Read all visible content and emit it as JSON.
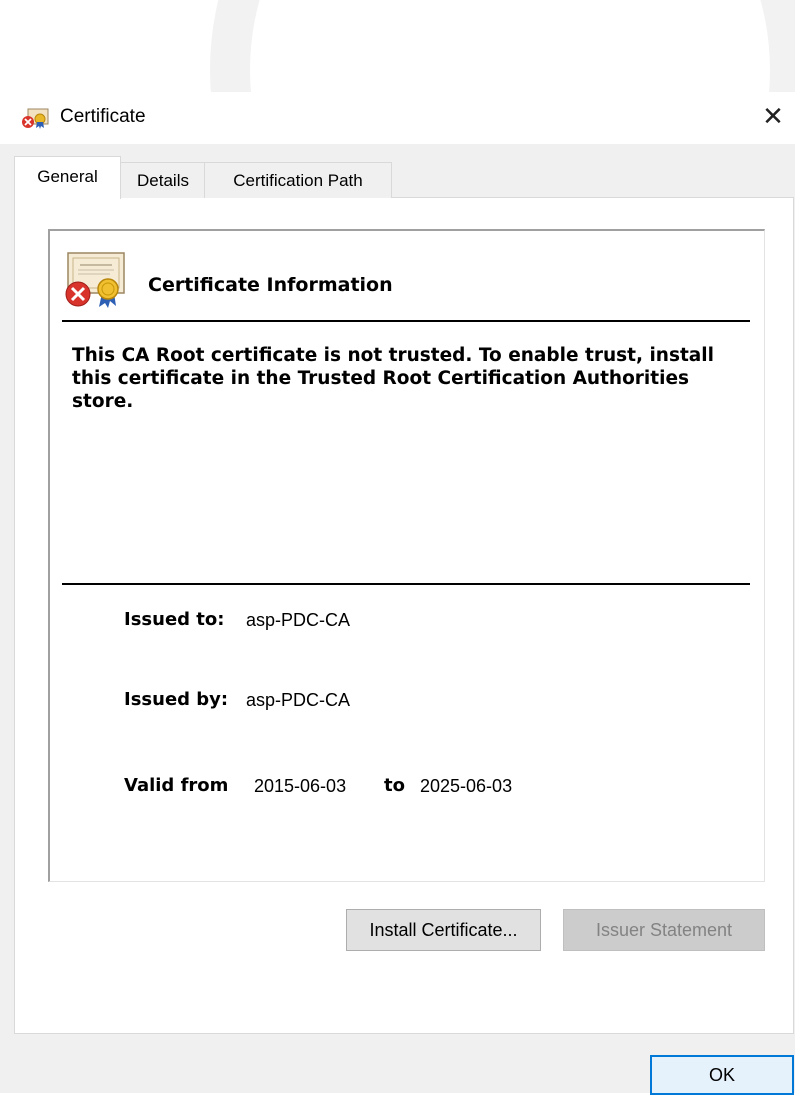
{
  "window": {
    "title": "Certificate",
    "close_glyph": "✕"
  },
  "tabs": [
    {
      "label": "General",
      "active": true
    },
    {
      "label": "Details",
      "active": false
    },
    {
      "label": "Certification Path",
      "active": false
    }
  ],
  "info": {
    "heading": "Certificate Information",
    "message": "This CA Root certificate is not trusted. To enable trust, install this certificate in the Trusted Root Certification Authorities store."
  },
  "fields": {
    "issued_to_label": "Issued to:",
    "issued_to_value": "asp-PDC-CA",
    "issued_by_label": "Issued by:",
    "issued_by_value": "asp-PDC-CA",
    "valid_from_label": "Valid from",
    "valid_from_value": "2015-06-03",
    "valid_to_label": "to",
    "valid_to_value": "2025-06-03"
  },
  "buttons": {
    "install": "Install Certificate...",
    "issuer_statement": "Issuer Statement",
    "ok": "OK"
  },
  "icons": {
    "title": "certificate-error-icon",
    "cert": "certificate-untrusted-icon"
  },
  "colors": {
    "accent": "#0078d7",
    "error_red": "#d9342b"
  }
}
